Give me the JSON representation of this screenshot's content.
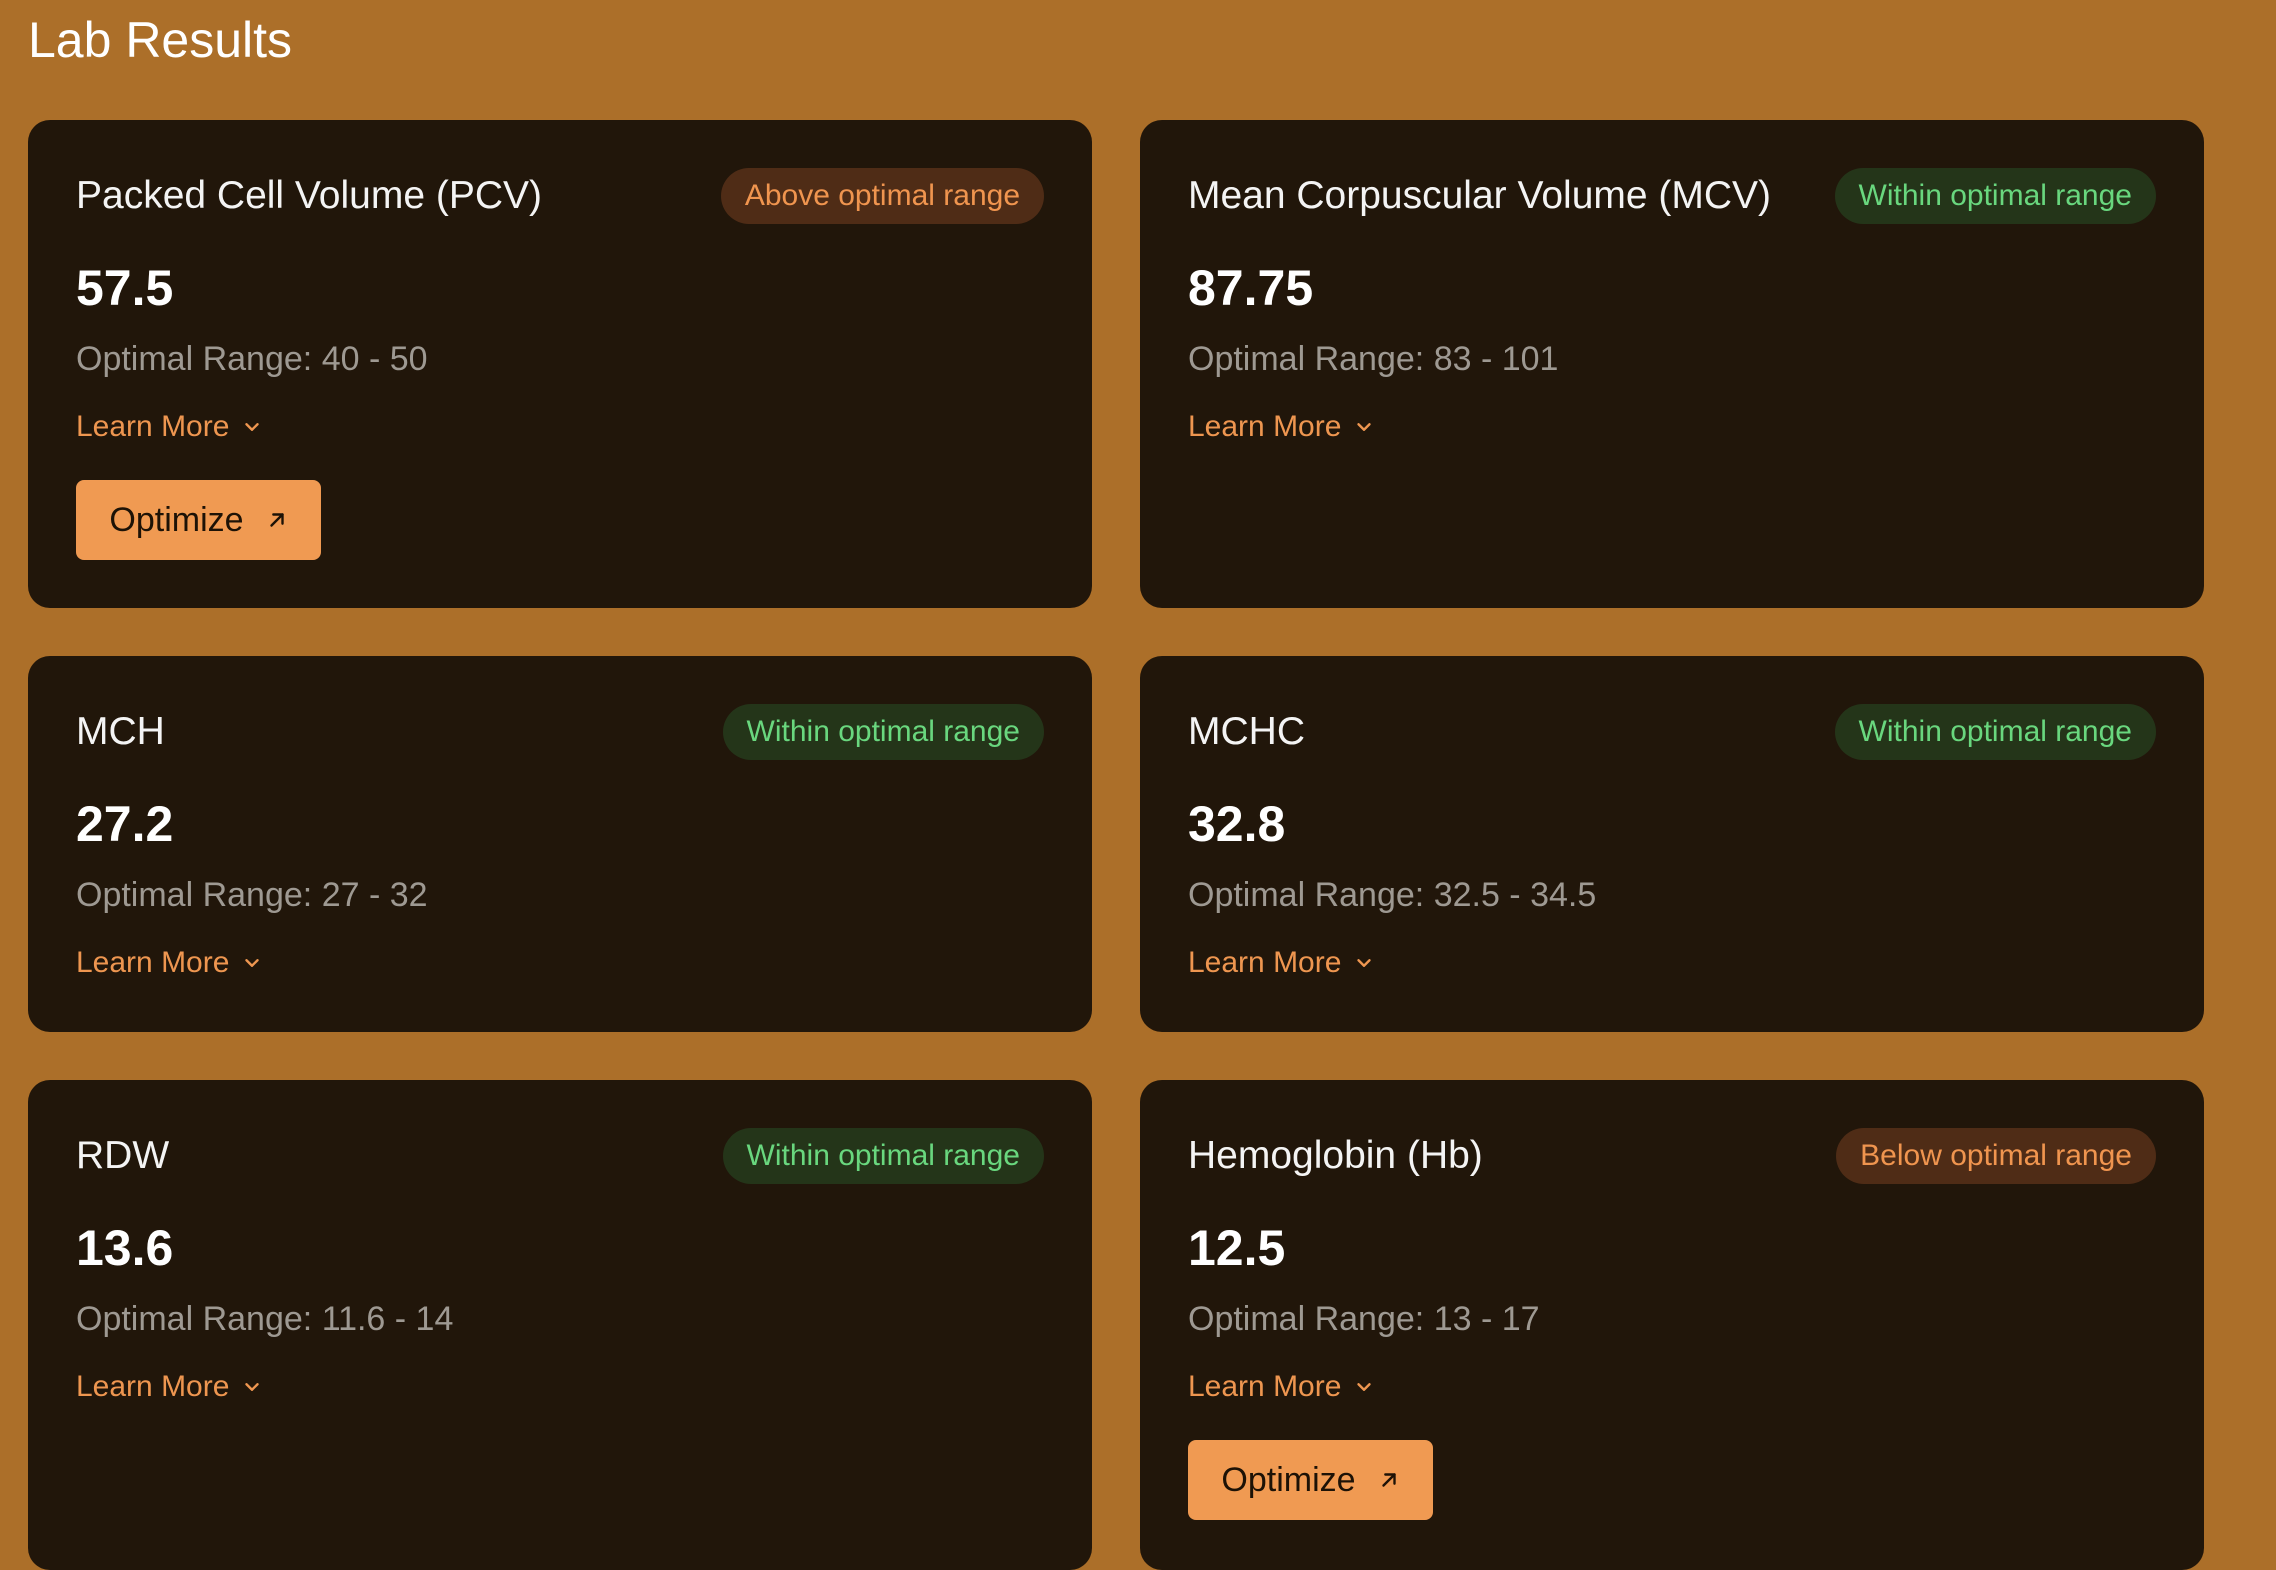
{
  "page": {
    "title": "Lab Results"
  },
  "cards": [
    {
      "name": "Packed Cell Volume (PCV)",
      "status": "Above optimal range",
      "status_type": "above",
      "value": "57.5",
      "range_label": "Optimal Range:",
      "range": "40 - 50",
      "learn_more": "Learn More",
      "optimize": "Optimize"
    },
    {
      "name": "Mean Corpuscular Volume (MCV)",
      "status": "Within optimal range",
      "status_type": "within",
      "value": "87.75",
      "range_label": "Optimal Range:",
      "range": "83 - 101",
      "learn_more": "Learn More"
    },
    {
      "name": "MCH",
      "status": "Within optimal range",
      "status_type": "within",
      "value": "27.2",
      "range_label": "Optimal Range:",
      "range": "27 - 32",
      "learn_more": "Learn More"
    },
    {
      "name": "MCHC",
      "status": "Within optimal range",
      "status_type": "within",
      "value": "32.8",
      "range_label": "Optimal Range:",
      "range": "32.5 - 34.5",
      "learn_more": "Learn More"
    },
    {
      "name": "RDW",
      "status": "Within optimal range",
      "status_type": "within",
      "value": "13.6",
      "range_label": "Optimal Range:",
      "range": "11.6 - 14",
      "learn_more": "Learn More"
    },
    {
      "name": "Hemoglobin (Hb)",
      "status": "Below optimal range",
      "status_type": "below",
      "value": "12.5",
      "range_label": "Optimal Range:",
      "range": "13 - 17",
      "learn_more": "Learn More",
      "optimize": "Optimize"
    }
  ],
  "colors": {
    "page_background": "#ac6f29",
    "card_background": "#21160a",
    "accent": "#f09a52",
    "within_text": "#69d77e",
    "within_bg": "#243519",
    "out_of_range_text": "#f0954f",
    "out_of_range_bg": "#4f2c16"
  },
  "icons": {
    "learn_more": "chevron-down-icon",
    "optimize": "arrow-up-right-icon"
  }
}
